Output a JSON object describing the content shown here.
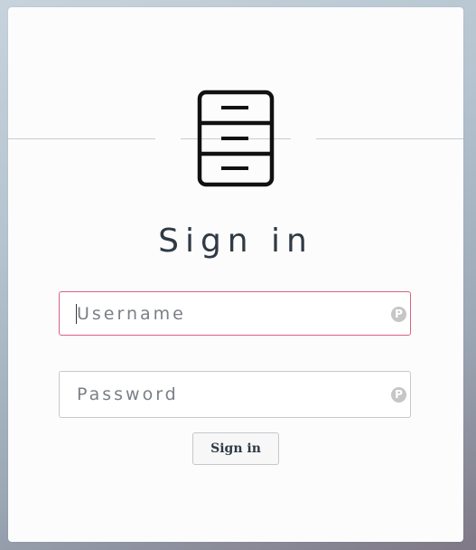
{
  "app": {
    "logo_icon": "filing-cabinet-icon"
  },
  "login": {
    "title": "Sign in",
    "username": {
      "placeholder": "Username",
      "value": "",
      "manager_icon": "password-manager-icon",
      "manager_glyph": "P"
    },
    "password": {
      "placeholder": "Password",
      "value": "",
      "manager_icon": "password-manager-icon",
      "manager_glyph": "P"
    },
    "submit_label": "Sign in"
  },
  "colors": {
    "focus_border": "#d9607f",
    "text": "#2f3a45",
    "card": "#fcfcfd"
  }
}
